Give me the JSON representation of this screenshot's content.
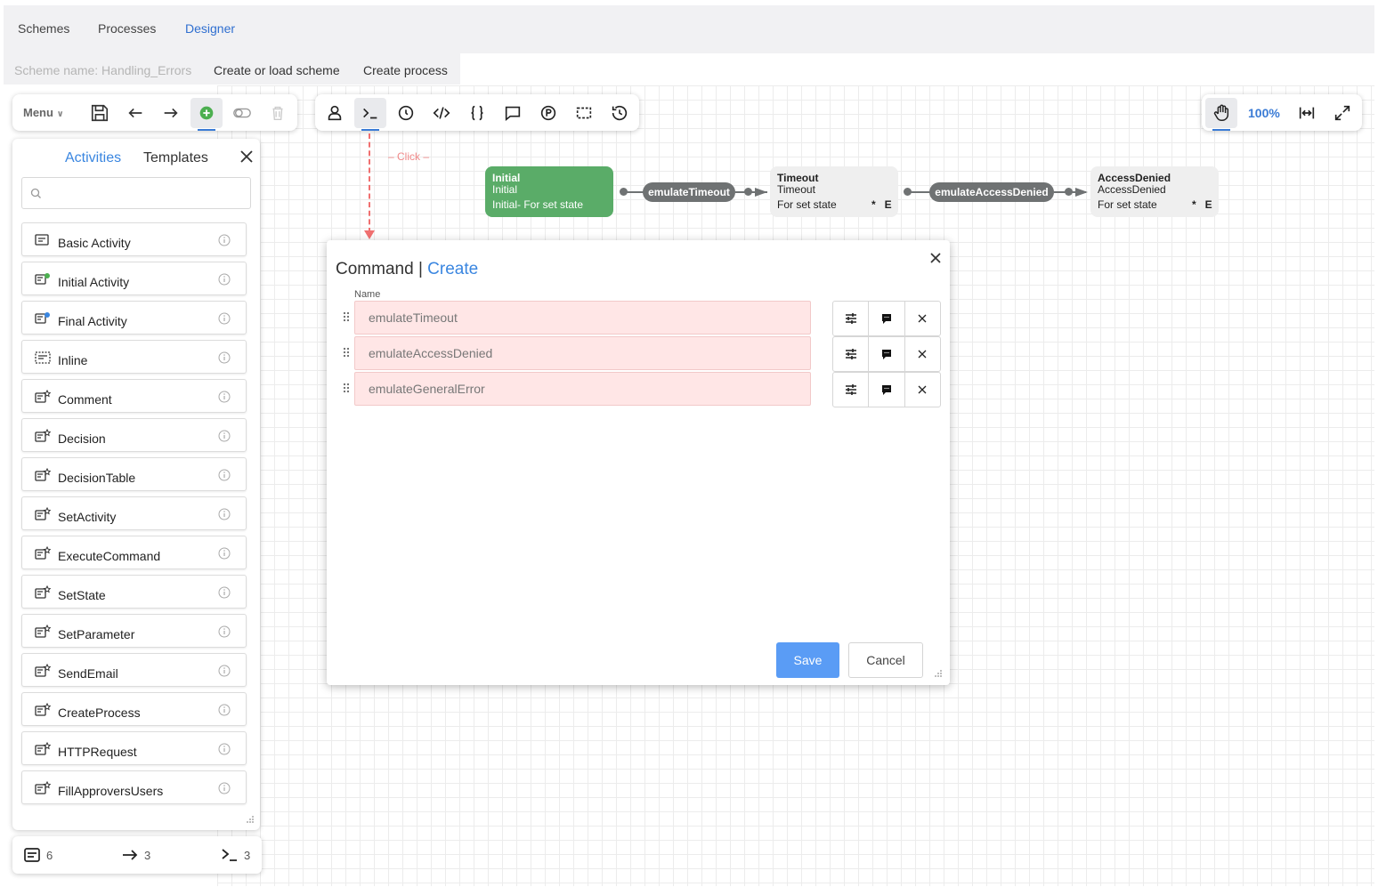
{
  "nav": {
    "tabs": [
      {
        "label": "Schemes"
      },
      {
        "label": "Processes"
      },
      {
        "label": "Designer"
      }
    ]
  },
  "scheme": {
    "name_label": "Scheme name: Handling_Errors",
    "create_or_load": "Create or load scheme",
    "create_process": "Create process"
  },
  "toolbar": {
    "menu_label": "Menu",
    "zoom_label": "100%"
  },
  "panel": {
    "tab_activities": "Activities",
    "tab_templates": "Templates",
    "search_placeholder": "",
    "items": [
      {
        "label": "Basic Activity"
      },
      {
        "label": "Initial Activity"
      },
      {
        "label": "Final Activity"
      },
      {
        "label": "Inline"
      },
      {
        "label": "Comment"
      },
      {
        "label": "Decision"
      },
      {
        "label": "DecisionTable"
      },
      {
        "label": "SetActivity"
      },
      {
        "label": "ExecuteCommand"
      },
      {
        "label": "SetState"
      },
      {
        "label": "SetParameter"
      },
      {
        "label": "SendEmail"
      },
      {
        "label": "CreateProcess"
      },
      {
        "label": "HTTPRequest"
      },
      {
        "label": "FillApproversUsers"
      }
    ]
  },
  "footer": {
    "activities_count": "6",
    "transitions_count": "3",
    "commands_count": "3"
  },
  "hint": {
    "click_label": "Click"
  },
  "diagram": {
    "states": [
      {
        "title": "Initial",
        "subtitle": "Initial",
        "detail": "Initial- For set state",
        "flags": ""
      },
      {
        "title": "Timeout",
        "subtitle": "Timeout",
        "detail": "For set state",
        "flags": "*   E"
      },
      {
        "title": "AccessDenied",
        "subtitle": "AccessDenied",
        "detail": "For set state",
        "flags": "*   E"
      }
    ],
    "transitions": [
      {
        "label": "emulateTimeout"
      },
      {
        "label": "emulateAccessDenied"
      }
    ]
  },
  "dialog": {
    "title": "Command",
    "separator": "|",
    "mode": "Create",
    "column_name": "Name",
    "commands": [
      {
        "value": "emulateTimeout"
      },
      {
        "value": "emulateAccessDenied"
      },
      {
        "value": "emulateGeneralError"
      }
    ],
    "save_label": "Save",
    "cancel_label": "Cancel"
  },
  "colors": {
    "accent": "#3a86e0",
    "initial_state": "#5aac68",
    "transition": "#6f7273",
    "invalid_input": "#ffe6e6",
    "save_button": "#5a9cf5"
  }
}
